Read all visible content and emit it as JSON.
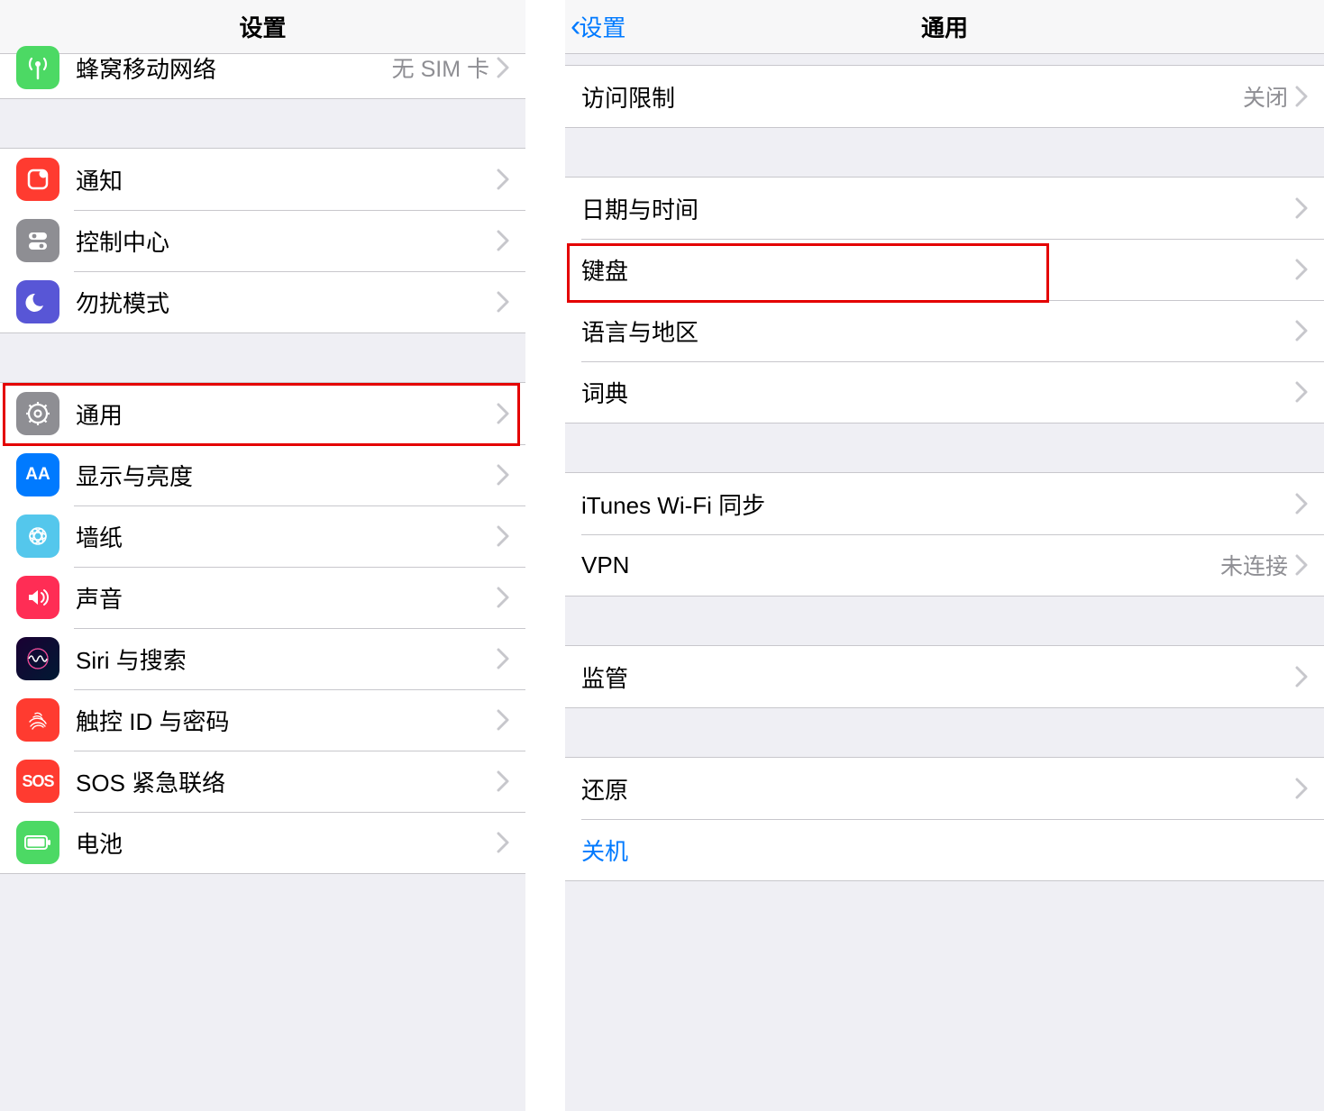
{
  "left": {
    "title": "设置",
    "groups": [
      {
        "rows": [
          {
            "id": "cellular",
            "icon": "cellular-icon",
            "label": "蜂窝移动网络",
            "value": "无 SIM 卡"
          }
        ]
      },
      {
        "rows": [
          {
            "id": "notifications",
            "icon": "notifications-icon",
            "label": "通知"
          },
          {
            "id": "control-center",
            "icon": "control-center-icon",
            "label": "控制中心"
          },
          {
            "id": "dnd",
            "icon": "dnd-icon",
            "label": "勿扰模式"
          }
        ]
      },
      {
        "rows": [
          {
            "id": "general",
            "icon": "general-icon",
            "label": "通用",
            "highlight": true
          },
          {
            "id": "display",
            "icon": "display-icon",
            "label": "显示与亮度"
          },
          {
            "id": "wallpaper",
            "icon": "wallpaper-icon",
            "label": "墙纸"
          },
          {
            "id": "sounds",
            "icon": "sounds-icon",
            "label": "声音"
          },
          {
            "id": "siri",
            "icon": "siri-icon",
            "label": "Siri 与搜索"
          },
          {
            "id": "touchid",
            "icon": "touchid-icon",
            "label": "触控 ID 与密码"
          },
          {
            "id": "sos",
            "icon": "sos-icon",
            "label": "SOS 紧急联络"
          },
          {
            "id": "battery",
            "icon": "battery-icon",
            "label": "电池"
          }
        ]
      }
    ]
  },
  "right": {
    "back": "设置",
    "title": "通用",
    "groups": [
      {
        "rows": [
          {
            "id": "restrictions",
            "label": "访问限制",
            "value": "关闭"
          }
        ]
      },
      {
        "rows": [
          {
            "id": "date-time",
            "label": "日期与时间"
          },
          {
            "id": "keyboard",
            "label": "键盘",
            "highlight": true
          },
          {
            "id": "language-region",
            "label": "语言与地区"
          },
          {
            "id": "dictionary",
            "label": "词典"
          }
        ]
      },
      {
        "rows": [
          {
            "id": "itunes-wifi-sync",
            "label": "iTunes Wi-Fi 同步"
          },
          {
            "id": "vpn",
            "label": "VPN",
            "value": "未连接"
          }
        ]
      },
      {
        "rows": [
          {
            "id": "regulatory",
            "label": "监管"
          }
        ]
      },
      {
        "rows": [
          {
            "id": "reset",
            "label": "还原"
          },
          {
            "id": "shutdown",
            "label": "关机",
            "link": true,
            "no_chevron": true
          }
        ]
      }
    ]
  }
}
